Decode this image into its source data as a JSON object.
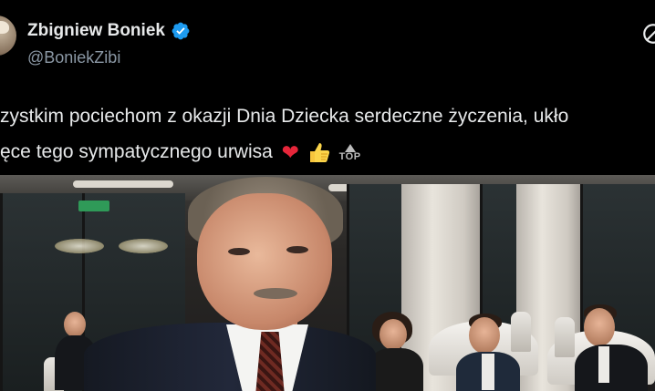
{
  "author": {
    "display_name": "Zbigniew Boniek",
    "handle": "@BoniekZibi",
    "verified": true,
    "verified_color": "#1d9bf0"
  },
  "tweet": {
    "line1": "zystkim pociechom z okazji Dnia Dziecka serdeczne życzenia, ukło",
    "line2": "ęce tego sympatycznego urwisa",
    "emojis": [
      "red-heart",
      "thumbs-up"
    ],
    "top_badge": "TOP"
  },
  "colors": {
    "background": "#000000",
    "text": "#e7e9ea",
    "secondary_text": "#8b98a5",
    "heart": "#e6263a"
  },
  "icons": [
    "verified-badge-icon",
    "grok-icon",
    "heart-emoji",
    "thumbs-up-emoji",
    "top-arrow-icon"
  ]
}
